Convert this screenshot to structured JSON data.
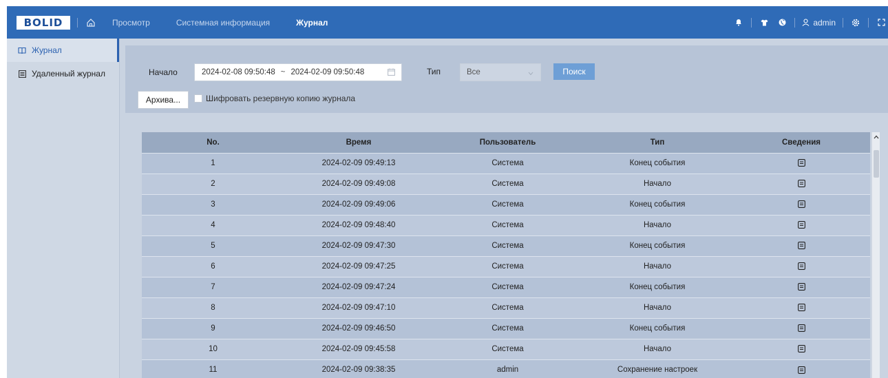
{
  "header": {
    "logo": "BOLID",
    "nav": [
      {
        "label": "Просмотр",
        "active": false
      },
      {
        "label": "Системная информация",
        "active": false
      },
      {
        "label": "Журнал",
        "active": true
      }
    ],
    "user": "admin",
    "icons": [
      "home-icon",
      "bell-icon",
      "shirt-icon",
      "globe-icon",
      "user-icon",
      "gear-icon",
      "fullscreen-icon"
    ],
    "colors": {
      "bar": "#2f6bb7",
      "accent": "#2b61b0",
      "button": "#6e9fd6"
    }
  },
  "sidebar": {
    "items": [
      {
        "label": "Журнал",
        "active": true,
        "icon": "book-icon"
      },
      {
        "label": "Удаленный журнал",
        "active": false,
        "icon": "list-icon"
      }
    ]
  },
  "filter": {
    "start_label": "Начало",
    "date_from": "2024-02-08 09:50:48",
    "date_sep": "~",
    "date_to": "2024-02-09 09:50:48",
    "type_label": "Тип",
    "type_value": "Все",
    "search_label": "Поиск",
    "archive_label": "Архива...",
    "encrypt_label": "Шифровать резервную копию журнала",
    "encrypt_checked": false
  },
  "table": {
    "columns": [
      "No.",
      "Время",
      "Пользователь",
      "Тип",
      "Сведения"
    ],
    "rows": [
      {
        "no": "1",
        "time": "2024-02-09 09:49:13",
        "user": "Система",
        "type": "Конец события"
      },
      {
        "no": "2",
        "time": "2024-02-09 09:49:08",
        "user": "Система",
        "type": "Начало"
      },
      {
        "no": "3",
        "time": "2024-02-09 09:49:06",
        "user": "Система",
        "type": "Конец события"
      },
      {
        "no": "4",
        "time": "2024-02-09 09:48:40",
        "user": "Система",
        "type": "Начало"
      },
      {
        "no": "5",
        "time": "2024-02-09 09:47:30",
        "user": "Система",
        "type": "Конец события"
      },
      {
        "no": "6",
        "time": "2024-02-09 09:47:25",
        "user": "Система",
        "type": "Начало"
      },
      {
        "no": "7",
        "time": "2024-02-09 09:47:24",
        "user": "Система",
        "type": "Конец события"
      },
      {
        "no": "8",
        "time": "2024-02-09 09:47:10",
        "user": "Система",
        "type": "Начало"
      },
      {
        "no": "9",
        "time": "2024-02-09 09:46:50",
        "user": "Система",
        "type": "Конец события"
      },
      {
        "no": "10",
        "time": "2024-02-09 09:45:58",
        "user": "Система",
        "type": "Начало"
      },
      {
        "no": "11",
        "time": "2024-02-09 09:38:35",
        "user": "admin",
        "type": "Сохранение настроек"
      }
    ]
  }
}
